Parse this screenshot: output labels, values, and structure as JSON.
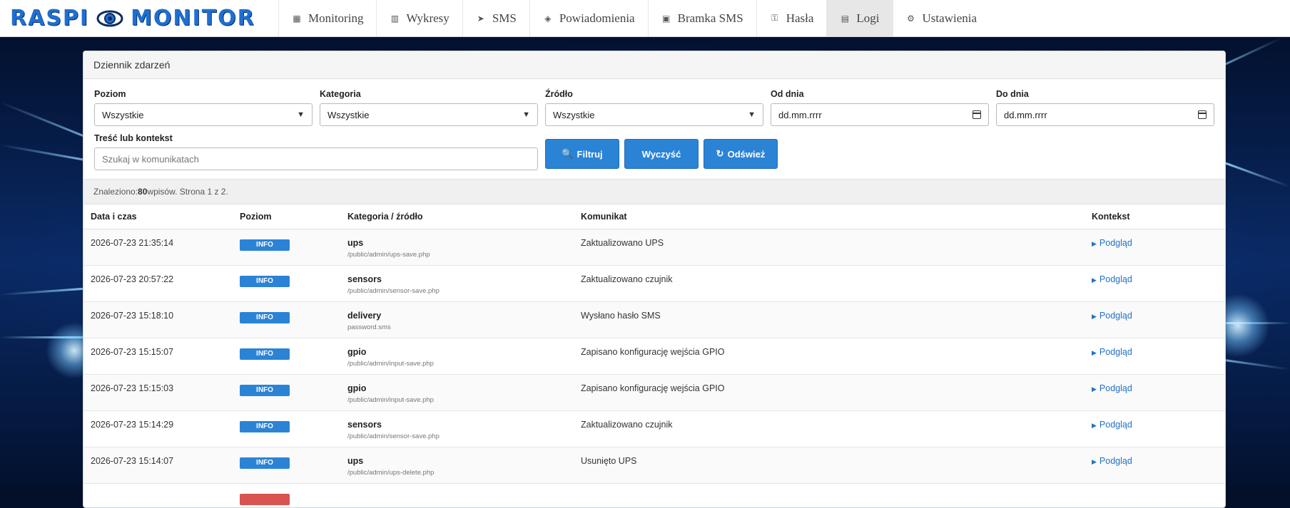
{
  "app": {
    "logo_text": "RASPI",
    "logo_text2": "MONITOR"
  },
  "nav": [
    {
      "label": "Monitoring",
      "icon": "▦",
      "active": false
    },
    {
      "label": "Wykresy",
      "icon": "▥",
      "active": false
    },
    {
      "label": "SMS",
      "icon": "➤",
      "active": false
    },
    {
      "label": "Powiadomienia",
      "icon": "◈",
      "active": false
    },
    {
      "label": "Bramka SMS",
      "icon": "▣",
      "active": false
    },
    {
      "label": "Hasła",
      "icon": "⚿",
      "active": false
    },
    {
      "label": "Logi",
      "icon": "▤",
      "active": true
    },
    {
      "label": "Ustawienia",
      "icon": "⚙",
      "active": false
    }
  ],
  "panel": {
    "title": "Dziennik zdarzeń"
  },
  "filters": {
    "level_label": "Poziom",
    "level_value": "Wszystkie",
    "category_label": "Kategoria",
    "category_value": "Wszystkie",
    "source_label": "Źródło",
    "source_value": "Wszystkie",
    "from_label": "Od dnia",
    "from_value": "dd.mm.rrrr",
    "to_label": "Do dnia",
    "to_value": "dd.mm.rrrr",
    "text_label": "Treść lub kontekst",
    "text_placeholder": "Szukaj w komunikatach",
    "filter_button": "Filtruj",
    "clear_button": "Wyczyść",
    "refresh_button": "Odśwież"
  },
  "summary": {
    "prefix": "Znaleziono: ",
    "count": "80",
    "suffix": " wpisów. Strona 1 z 2."
  },
  "table": {
    "headers": [
      "Data i czas",
      "Poziom",
      "Kategoria / źródło",
      "Komunikat",
      "Kontekst"
    ],
    "rows": [
      {
        "datetime": "2026-07-23 21:35:14",
        "level": "INFO",
        "category": "ups",
        "source": "/public/admin/ups-save.php",
        "message": "Zaktualizowano UPS",
        "context": "Podgląd"
      },
      {
        "datetime": "2026-07-23 20:57:22",
        "level": "INFO",
        "category": "sensors",
        "source": "/public/admin/sensor-save.php",
        "message": "Zaktualizowano czujnik",
        "context": "Podgląd"
      },
      {
        "datetime": "2026-07-23 15:18:10",
        "level": "INFO",
        "category": "delivery",
        "source": "password.sms",
        "message": "Wysłano hasło SMS",
        "context": "Podgląd"
      },
      {
        "datetime": "2026-07-23 15:15:07",
        "level": "INFO",
        "category": "gpio",
        "source": "/public/admin/input-save.php",
        "message": "Zapisano konfigurację wejścia GPIO",
        "context": "Podgląd"
      },
      {
        "datetime": "2026-07-23 15:15:03",
        "level": "INFO",
        "category": "gpio",
        "source": "/public/admin/input-save.php",
        "message": "Zapisano konfigurację wejścia GPIO",
        "context": "Podgląd"
      },
      {
        "datetime": "2026-07-23 15:14:29",
        "level": "INFO",
        "category": "sensors",
        "source": "/public/admin/sensor-save.php",
        "message": "Zaktualizowano czujnik",
        "context": "Podgląd"
      },
      {
        "datetime": "2026-07-23 15:14:07",
        "level": "INFO",
        "category": "ups",
        "source": "/public/admin/ups-delete.php",
        "message": "Usunięto UPS",
        "context": "Podgląd"
      }
    ]
  },
  "colors": {
    "accent": "#2b83d6",
    "error": "#d9534f",
    "link": "#2172c4"
  }
}
